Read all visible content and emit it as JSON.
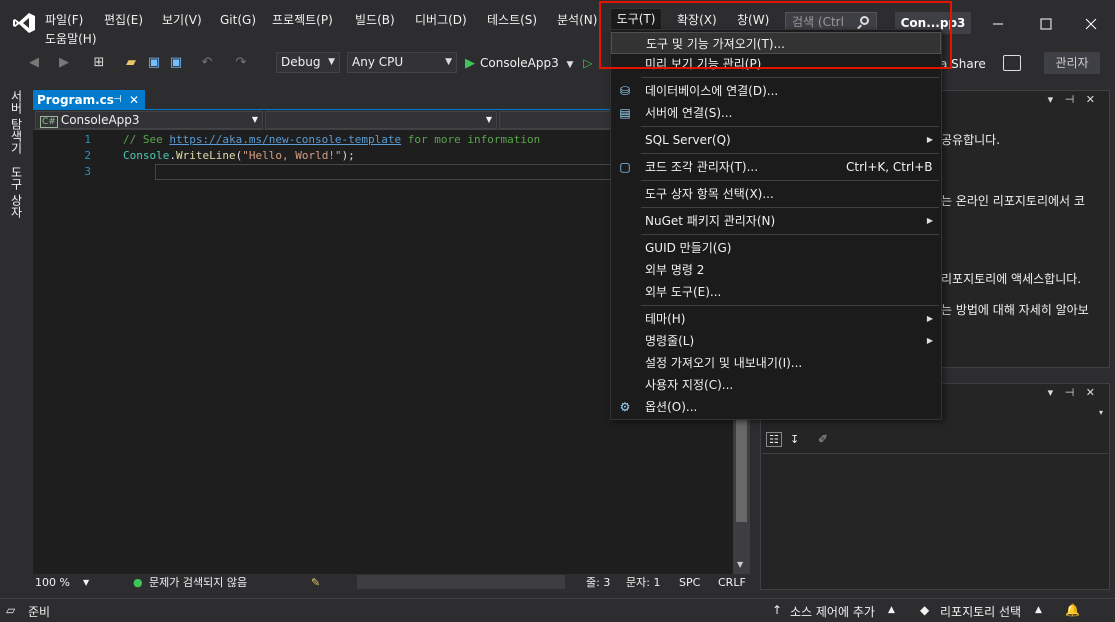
{
  "menu": {
    "items": [
      "파일(F)",
      "편집(E)",
      "보기(V)",
      "Git(G)",
      "프로젝트(P)",
      "빌드(B)",
      "디버그(D)",
      "테스트(S)",
      "분석(N)",
      "도구(T)",
      "확장(X)",
      "창(W)"
    ],
    "help": "도움말(H)",
    "search_placeholder": "검색 (Ctrl",
    "solution_name": "Con...pp3"
  },
  "toolbar": {
    "config": "Debug",
    "platform": "Any CPU",
    "run_target": "ConsoleApp3",
    "live_share": "a Share",
    "admin": "관리자"
  },
  "left_tabs": [
    "서버 탐색기",
    "도구 상자"
  ],
  "editor": {
    "tab_name": "Program.cs",
    "project_combo": "ConsoleApp3",
    "line_numbers": [
      "1",
      "2",
      "3"
    ],
    "line1_comment_prefix": "// See ",
    "line1_link": "https://aka.ms/new-console-template",
    "line1_comment_suffix": " for more information",
    "line2_class": "Console",
    "line2_dot": ".",
    "line2_method": "WriteLine",
    "line2_open": "(",
    "line2_string": "\"Hello, World!\"",
    "line2_close": ");",
    "zoom": "100 %",
    "issues": "문제가 검색되지 않음",
    "line_info": "줄: 3",
    "char_info": "문자: 1",
    "spc": "SPC",
    "crlf": "CRLF"
  },
  "tools_menu": {
    "header": "도구(T)",
    "items": [
      {
        "label": "도구 및 기능 가져오기(T)...",
        "shortcut": "",
        "submenu": false,
        "icon": ""
      },
      {
        "label": "미리 보기 기능 관리(P)",
        "shortcut": "",
        "submenu": false,
        "icon": ""
      },
      {
        "label": "데이터베이스에 연결(D)...",
        "shortcut": "",
        "submenu": false,
        "icon": "database-connect-icon"
      },
      {
        "label": "서버에 연결(S)...",
        "shortcut": "",
        "submenu": false,
        "icon": "server-connect-icon"
      },
      {
        "label": "SQL Server(Q)",
        "shortcut": "",
        "submenu": true,
        "icon": ""
      },
      {
        "label": "코드 조각 관리자(T)...",
        "shortcut": "Ctrl+K, Ctrl+B",
        "submenu": false,
        "icon": "snippet-icon"
      },
      {
        "label": "도구 상자 항목 선택(X)...",
        "shortcut": "",
        "submenu": false,
        "icon": ""
      },
      {
        "label": "NuGet 패키지 관리자(N)",
        "shortcut": "",
        "submenu": true,
        "icon": ""
      },
      {
        "label": "GUID 만들기(G)",
        "shortcut": "",
        "submenu": false,
        "icon": ""
      },
      {
        "label": "외부 명령 2",
        "shortcut": "",
        "submenu": false,
        "icon": ""
      },
      {
        "label": "외부 도구(E)...",
        "shortcut": "",
        "submenu": false,
        "icon": ""
      },
      {
        "label": "테마(H)",
        "shortcut": "",
        "submenu": true,
        "icon": ""
      },
      {
        "label": "명령줄(L)",
        "shortcut": "",
        "submenu": true,
        "icon": ""
      },
      {
        "label": "설정 가져오기 및 내보내기(I)...",
        "shortcut": "",
        "submenu": false,
        "icon": ""
      },
      {
        "label": "사용자 지정(C)...",
        "shortcut": "",
        "submenu": false,
        "icon": ""
      },
      {
        "label": "옵션(O)...",
        "shortcut": "",
        "submenu": false,
        "icon": "gear-icon"
      }
    ]
  },
  "right_panel": {
    "line1": "공유합니다.",
    "line2": "는 온라인 리포지토리에서 코",
    "line3": "리포지토리에 액세스합니다.",
    "line4": "는 방법에 대해 자세히 알아보"
  },
  "statusbar": {
    "ready": "준비",
    "source_control": "소스 제어에 추가",
    "repo_select": "리포지토리 선택"
  },
  "colors": {
    "accent": "#007acc",
    "highlight_box": "#e51400"
  }
}
